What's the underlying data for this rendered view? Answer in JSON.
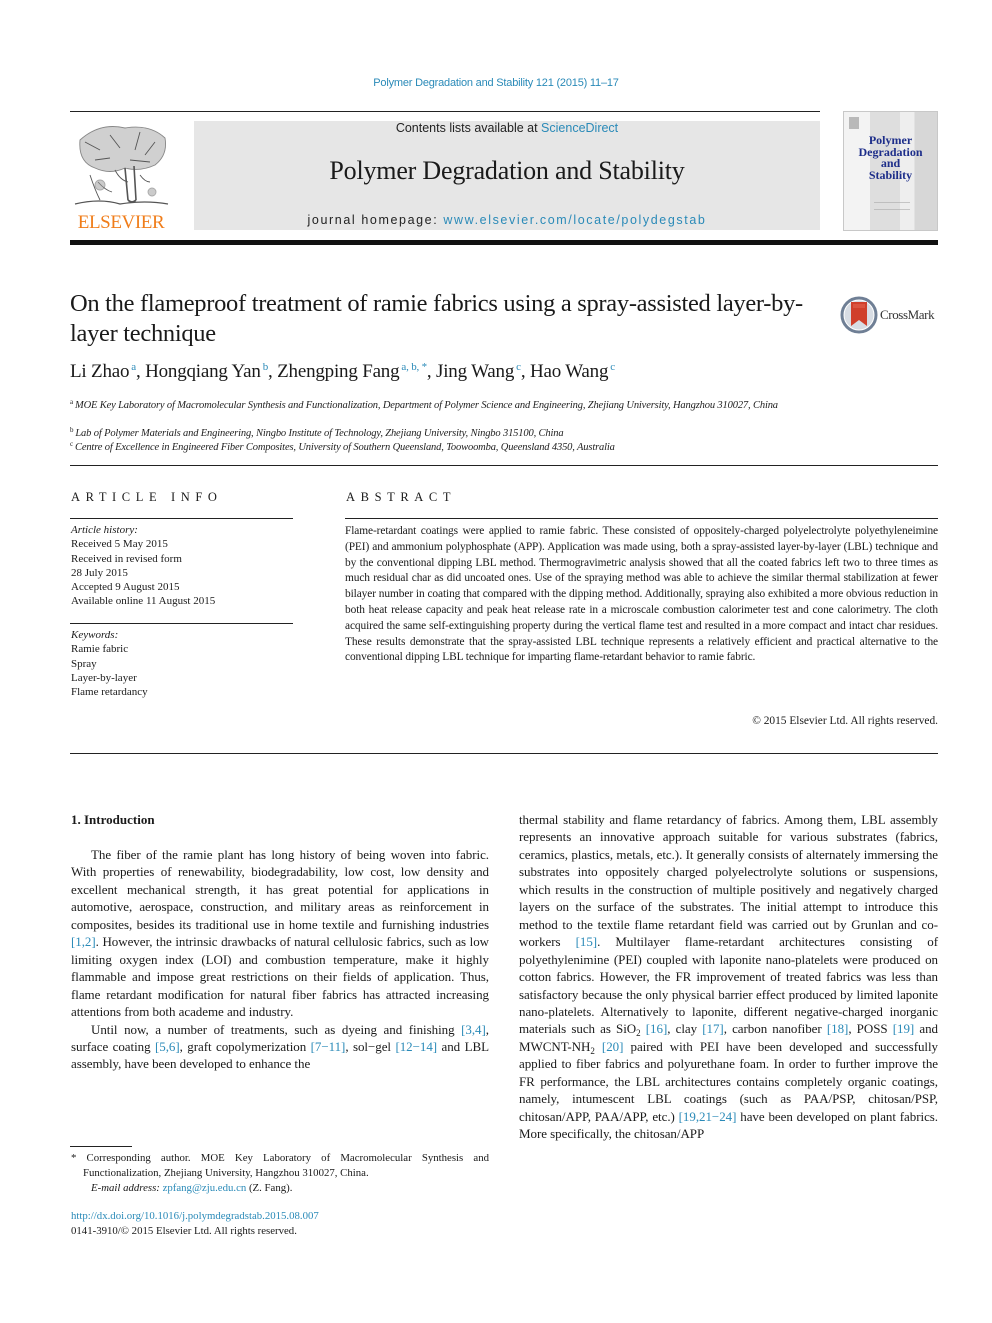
{
  "running_head": "Polymer Degradation and Stability 121 (2015) 11–17",
  "masthead": {
    "publisher_logo_text": "ELSEVIER",
    "contents_prefix": "Contents lists available at ",
    "contents_link": "ScienceDirect",
    "journal_title": "Polymer Degradation and Stability",
    "homepage_prefix": "journal homepage: ",
    "homepage_link": "www.elsevier.com/locate/polydegstab",
    "cover_title_lines": [
      "Polymer",
      "Degradation",
      "and",
      "Stability"
    ]
  },
  "article": {
    "title": "On the flameproof treatment of ramie fabrics using a spray-assisted layer-by-layer technique",
    "crossmark_label": "CrossMark",
    "authors": [
      {
        "name": "Li Zhao",
        "sup": "a"
      },
      {
        "name": "Hongqiang Yan",
        "sup": "b"
      },
      {
        "name": "Zhengping Fang",
        "sup": "a, b, *"
      },
      {
        "name": "Jing Wang",
        "sup": "c"
      },
      {
        "name": "Hao Wang",
        "sup": "c"
      }
    ],
    "affiliations": [
      {
        "mark": "a",
        "text": "MOE Key Laboratory of Macromolecular Synthesis and Functionalization, Department of Polymer Science and Engineering, Zhejiang University, Hangzhou 310027, China"
      },
      {
        "mark": "b",
        "text": "Lab of Polymer Materials and Engineering, Ningbo Institute of Technology, Zhejiang University, Ningbo 315100, China"
      },
      {
        "mark": "c",
        "text": "Centre of Excellence in Engineered Fiber Composites, University of Southern Queensland, Toowoomba, Queensland 4350, Australia"
      }
    ]
  },
  "article_info": {
    "heading": "ARTICLE INFO",
    "history_label": "Article history:",
    "history": [
      "Received 5 May 2015",
      "Received in revised form",
      "28 July 2015",
      "Accepted 9 August 2015",
      "Available online 11 August 2015"
    ],
    "keywords_label": "Keywords:",
    "keywords": [
      "Ramie fabric",
      "Spray",
      "Layer-by-layer",
      "Flame retardancy"
    ]
  },
  "abstract": {
    "heading": "ABSTRACT",
    "text": "Flame-retardant coatings were applied to ramie fabric. These consisted of oppositely-charged poly­electrolyte polyethyleneimine (PEI) and ammonium polyphosphate (APP). Application was made using, both a spray-assisted layer-by-layer (LBL) technique and by the conventional dipping LBL method. Thermogravimetric analysis showed that all the coated fabrics left two to three times as much residual char as did uncoated ones. Use of the spraying method was able to achieve the similar thermal stabi­lization at fewer bilayer number in coating that compared with the dipping method. Additionally, spraying also exhibited a more obvious reduction in both heat release capacity and peak heat release rate in a microscale combustion calorimeter test and cone calorimetry. The cloth acquired the same self-extinguishing property during the vertical flame test and resulted in a more compact and intact char residues. These results demonstrate that the spray-assisted LBL technique represents a relatively efficient and practical alternative to the conventional dipping LBL technique for imparting flame-retardant behavior to ramie fabric.",
    "copyright": "© 2015 Elsevier Ltd. All rights reserved."
  },
  "body": {
    "section_heading": "1.  Introduction",
    "left_p1": [
      {
        "t": "The fiber of the ramie plant has long history of being woven into fabric. With properties of renewability, biodegradability, low cost, low density and excellent mechanical strength, it has great po­tential for applications in automotive, aerospace, construction, and military areas as reinforcement in composites, besides its tradi­tional use in home textile and furnishing industries "
      },
      {
        "ref": "[1,2]"
      },
      {
        "t": ". However, the intrinsic drawbacks of natural cellulosic fabrics, such as low limiting oxygen index (LOI) and combustion temperature, make it highly flammable and impose great restrictions on their fields of application. Thus, flame retardant modification for natural fiber fabrics has attracted increasing attentions from both academe and industry."
      }
    ],
    "left_p2": [
      {
        "t": "Until now, a number of treatments, such as dyeing and finishing "
      },
      {
        "ref": "[3,4]"
      },
      {
        "t": ", surface coating "
      },
      {
        "ref": "[5,6]"
      },
      {
        "t": ", graft copolymerization "
      },
      {
        "ref": "[7−11]"
      },
      {
        "t": ", sol−gel "
      },
      {
        "ref": "[12−14]"
      },
      {
        "t": " and LBL assembly, have been developed to enhance the"
      }
    ],
    "right_p1": [
      {
        "t": "thermal stability and flame retardancy of fabrics. Among them, LBL assembly represents an innovative approach suitable for various substrates (fabrics, ceramics, plastics, metals, etc.). It generally consists of alternately immersing the substrates into oppositely charged polyelectrolyte solutions or suspensions, which results in the construction of multiple positively and negatively charged layers on the surface of the substrates. The initial attempt to introduce this method to the textile flame retardant field was car­ried out by Grunlan and co-workers "
      },
      {
        "ref": "[15]"
      },
      {
        "t": ". Multilayer flame-retardant architectures consisting of polyethylenimine (PEI) coupled with laponite nano-platelets were produced on cotton fabrics. However, the FR improvement of treated fabrics was less than satisfactory because the only physical barrier effect produced by limited laponite nano-platelets. Alternatively to laponite, different negative-charged inorganic materials such as SiO"
      },
      {
        "sub": "2"
      },
      {
        "t": " "
      },
      {
        "ref": "[16]"
      },
      {
        "t": ", clay "
      },
      {
        "ref": "[17]"
      },
      {
        "t": ", carbon nanofiber "
      },
      {
        "ref": "[18]"
      },
      {
        "t": ", POSS "
      },
      {
        "ref": "[19]"
      },
      {
        "t": " and MWCNT-NH"
      },
      {
        "sub": "2"
      },
      {
        "t": " "
      },
      {
        "ref": "[20]"
      },
      {
        "t": " paired with PEI have been developed and successfully applied to fiber fabrics and polyurethane foam. In order to further improve the FR performance, the LBL architectures contains completely organic coatings, namely, intumescent LBL coatings (such as PAA/PSP, chi­tosan/PSP, chitosan/APP, PAA/APP, etc.) "
      },
      {
        "ref": "[19,21−24]"
      },
      {
        "t": " have been developed on plant fabrics. More specifically, the chitosan/APP"
      }
    ]
  },
  "footnote": {
    "star_text": "* Corresponding author. MOE Key Laboratory of Macromolecular Synthesis and Functionalization, Zhejiang University, Hangzhou 310027, China.",
    "email_label": "E-mail address: ",
    "email": "zpfang@zju.edu.cn",
    "email_suffix": " (Z. Fang)."
  },
  "doi": "http://dx.doi.org/10.1016/j.polymdegradstab.2015.08.007",
  "issn": "0141-3910/© 2015 Elsevier Ltd. All rights reserved.",
  "colors": {
    "link": "#2a8ab8",
    "elsevier_orange": "#f07d1a",
    "cover_title": "#1d2e8a",
    "masthead_bg": "#e6e6e6"
  }
}
